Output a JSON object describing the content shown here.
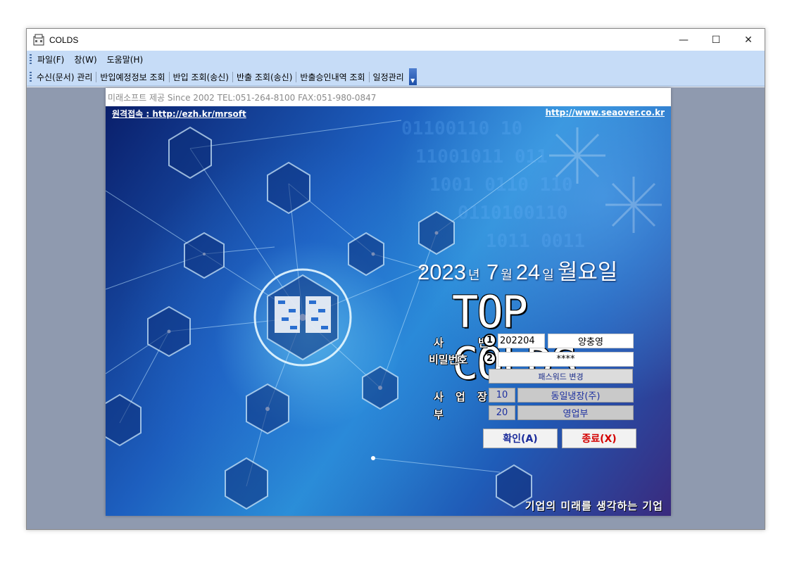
{
  "window": {
    "title": "COLDS",
    "controls": [
      "—",
      "☐",
      "✕"
    ]
  },
  "menu": [
    "파일(F)",
    "창(W)",
    "도움말(H)"
  ],
  "toolbar": [
    "수신(문서) 관리",
    "반입예정정보 조회",
    "반입 조회(송신)",
    "반출 조회(송신)",
    "반출승인내역 조회",
    "일정관리"
  ],
  "info_strip": "미래소프트 제공 Since 2002   TEL:051-264-8100   FAX:051-980-0847",
  "banner": {
    "remote_link": "원격접속 : http://ezh.kr/mrsoft",
    "site_link": "http://www.seaover.co.kr",
    "date": {
      "year": "2023",
      "year_unit": "년",
      "month": "7",
      "month_unit": "월",
      "day": "24",
      "day_unit": "일",
      "weekday": "월요일"
    },
    "title": "TOP COLDS",
    "slogan": "기업의 미래를 생각하는 기업"
  },
  "form": {
    "emp_label": "사 번",
    "emp_marker": "1",
    "emp_id": "202204",
    "emp_name": "양충영",
    "pw_label": "비밀번호",
    "pw_marker": "2",
    "pw_value": "****",
    "change_pw_label": "패스워드 변경",
    "site_label": "사 업 장",
    "site_code": "10",
    "site_name": "동일냉장(주)",
    "dept_label": "부 서",
    "dept_code": "20",
    "dept_name": "영업부",
    "ok_label": "확인(A)",
    "exit_label": "종료(X)"
  },
  "colors": {
    "menubar": "#c6dcf7",
    "client_bg": "#8f9aaf",
    "ok_text": "#1a2b9a",
    "exit_text": "#d40000"
  }
}
